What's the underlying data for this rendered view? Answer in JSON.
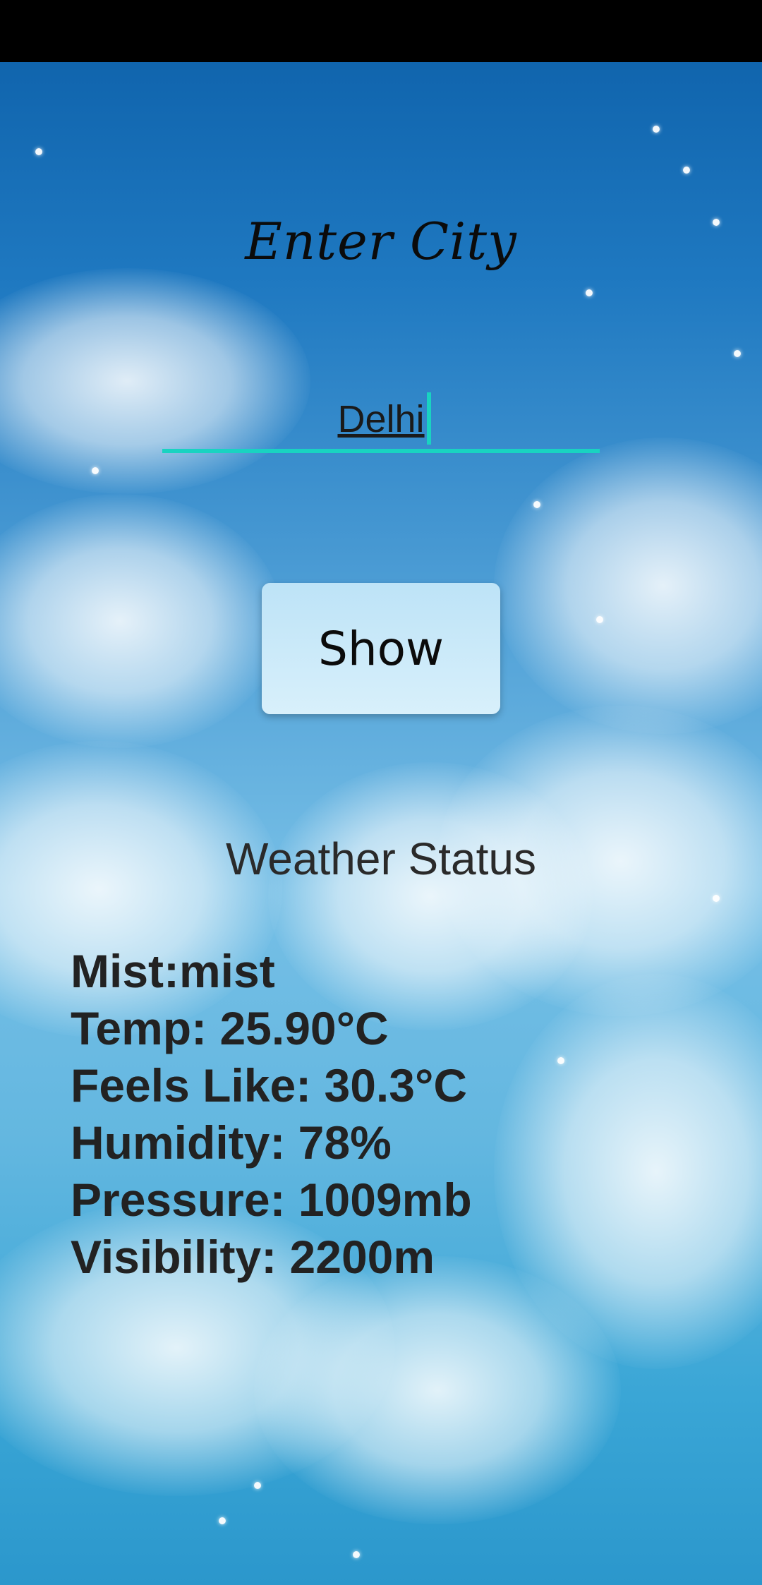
{
  "header": {
    "title": "Enter City"
  },
  "search": {
    "value": "Delhi",
    "show_label": "Show"
  },
  "weather": {
    "heading": "Weather Status",
    "condition": "Mist:mist",
    "temp": "Temp: 25.90°C",
    "feels_like": "Feels Like: 30.3°C",
    "humidity": "Humidity: 78%",
    "pressure": "Pressure: 1009mb",
    "visibility": "Visibility: 2200m"
  },
  "colors": {
    "accent": "#19d3c1",
    "status_bar": "#000000",
    "button_bg": "#c9e9f8"
  }
}
